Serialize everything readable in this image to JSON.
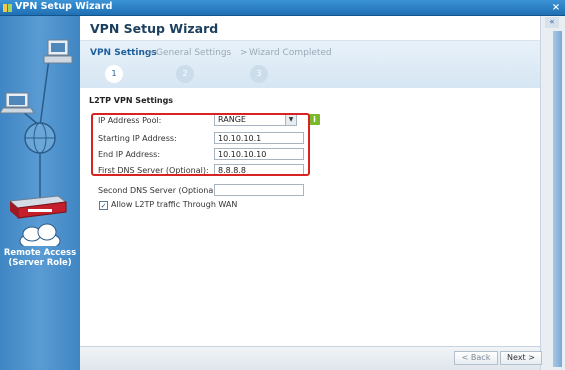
{
  "window": {
    "title": "VPN Setup Wizard",
    "close_glyph": "×"
  },
  "wizard": {
    "title": "VPN Setup Wizard",
    "steps": [
      {
        "label": "VPN Settings",
        "number": "1"
      },
      {
        "label": "General Settings",
        "number": "2"
      },
      {
        "label": "Wizard Completed",
        "number": "3"
      }
    ],
    "separator": ">"
  },
  "sidebar": {
    "role_label": "Remote Access\n(Server Role)"
  },
  "form": {
    "section_title": "L2TP VPN Settings",
    "ip_address_pool": {
      "label": "IP Address Pool:",
      "value": "RANGE",
      "info_glyph": "i"
    },
    "starting_ip": {
      "label": "Starting IP Address:",
      "value": "10.10.10.1"
    },
    "end_ip": {
      "label": "End IP Address:",
      "value": "10.10.10.10"
    },
    "first_dns": {
      "label": "First DNS Server (Optional):",
      "value": "8.8.8.8"
    },
    "second_dns": {
      "label": "Second DNS Server (Optional):",
      "value": ""
    },
    "allow_wan": {
      "label": "Allow L2TP traffic Through WAN",
      "checked": true,
      "check_glyph": "✓"
    }
  },
  "rail": {
    "collapse_glyph": "«"
  },
  "footer": {
    "back_label": "< Back",
    "next_label": "Next >"
  },
  "colors": {
    "title_blue": "#1d3f5f",
    "step_active": "#1d5e9c",
    "highlight": "#d82323",
    "info_green": "#7ab82c"
  }
}
